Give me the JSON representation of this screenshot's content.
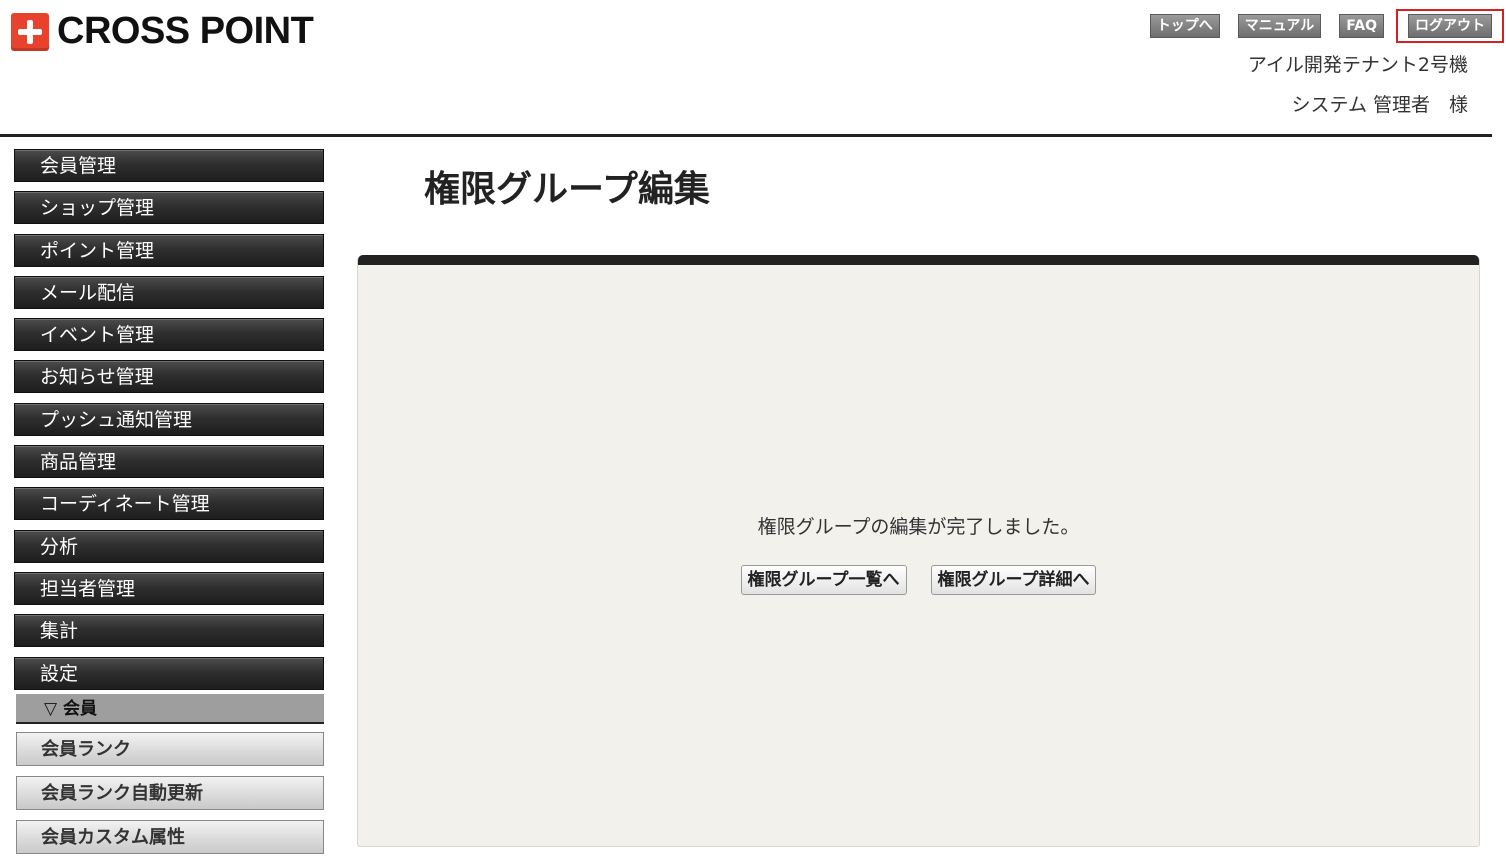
{
  "header": {
    "logo_text": "CROSS POINT",
    "links": {
      "top": "トップへ",
      "manual": "マニュアル",
      "faq": "FAQ",
      "logout": "ログアウト"
    },
    "tenant": "アイル開発テナント2号機",
    "user": "システム 管理者　様"
  },
  "sidebar": {
    "items": [
      "会員管理",
      "ショップ管理",
      "ポイント管理",
      "メール配信",
      "イベント管理",
      "お知らせ管理",
      "プッシュ通知管理",
      "商品管理",
      "コーディネート管理",
      "分析",
      "担当者管理",
      "集計",
      "設定"
    ],
    "submenu": {
      "header": "▽ 会員",
      "items": [
        "会員ランク",
        "会員ランク自動更新",
        "会員カスタム属性"
      ]
    }
  },
  "main": {
    "title": "権限グループ編集",
    "message": "権限グループの編集が完了しました。",
    "buttons": {
      "list": "権限グループ一覧へ",
      "detail": "権限グループ詳細へ"
    }
  },
  "colors": {
    "brand": "#e8412c",
    "highlight_border": "#d42121",
    "panel_bg": "#f2f1ec"
  }
}
